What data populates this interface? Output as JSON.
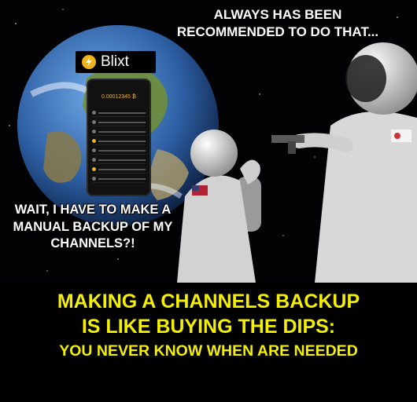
{
  "captions": {
    "top": "ALWAYS HAS BEEN RECOMMENDED TO DO THAT...",
    "left": "WAIT, I HAVE TO MAKE A MANUAL BACKUP OF MY CHANNELS?!"
  },
  "logo": {
    "text": "Blixt",
    "icon": "lightning-bolt-icon"
  },
  "phone": {
    "balance": "0.00012345 ₿"
  },
  "bottom_lines": [
    "MAKING A CHANNELS BACKUP",
    "IS LIKE BUYING THE DIPS:",
    "YOU NEVER KNOW WHEN ARE NEEDED"
  ],
  "colors": {
    "caption": "#ffffff",
    "bottom_text": "#f4f000",
    "brand": "#f2b21c"
  }
}
